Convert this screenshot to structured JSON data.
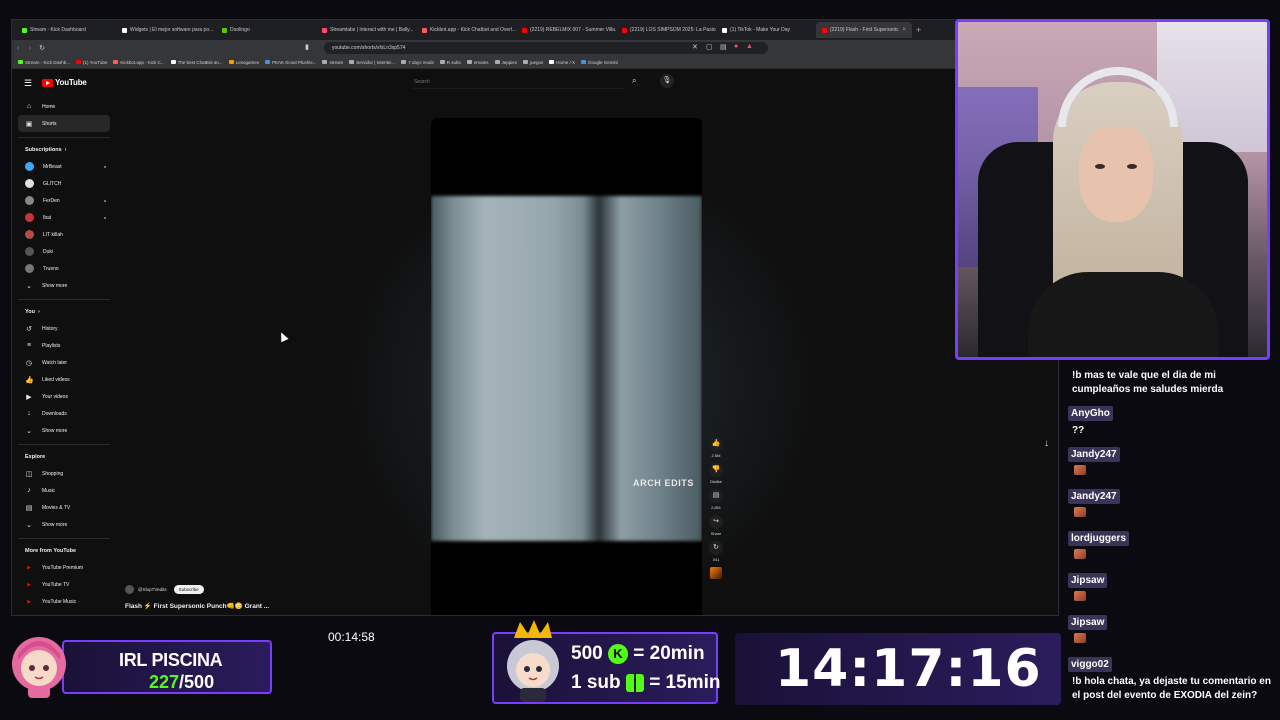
{
  "browser": {
    "tabs": [
      {
        "label": "Stream - Kick Dashboard",
        "color": "#53fc18"
      },
      {
        "label": "Widgets | El mejor software para po...",
        "color": "#ffffff"
      },
      {
        "label": "Duolingo",
        "color": "#58cc02"
      },
      {
        "label": "Streamlabs | Interact with me | Bally...",
        "color": "#ff4a6b"
      },
      {
        "label": "Kickbot.app - Kick Chatbot and Overl...",
        "color": "#ff5b5b"
      },
      {
        "label": "(2219) REBELMIX 007 - Summer Villa...",
        "color": "#ff0000"
      },
      {
        "label": "(2219) LOS SIMPSOM 2025: La Pasio...",
        "color": "#ff0000"
      },
      {
        "label": "(1) TikTok - Make Your Day",
        "color": "#ffffff"
      },
      {
        "label": "(2219) Flash - First Supersonic",
        "color": "#ff0000",
        "active": true
      }
    ],
    "new_tab": "+",
    "url": "youtube.com/shorts/xfxLn3xp574",
    "bookmarks": [
      {
        "label": "Stream - Kick Dashb...",
        "color": "#53fc18"
      },
      {
        "label": "(1) YouTube",
        "color": "#ff0000"
      },
      {
        "label": "Kickbot.app - Kick C...",
        "color": "#ff5b5b"
      },
      {
        "label": "The best ChatBot an...",
        "color": "#ffffff"
      },
      {
        "label": "Lesogames",
        "color": "#ff9a00"
      },
      {
        "label": "PEAK Scout Plushie...",
        "color": "#4a90e2"
      },
      {
        "label": "stream",
        "color": "#aaaaaa"
      },
      {
        "label": "Servidor | Intentei...",
        "color": "#aaaaaa"
      },
      {
        "label": "7 days mods",
        "color": "#aaaaaa"
      },
      {
        "label": "R subs",
        "color": "#aaaaaa"
      },
      {
        "label": "emotes",
        "color": "#aaaaaa"
      },
      {
        "label": "Jeppies",
        "color": "#aaaaaa"
      },
      {
        "label": "juegos",
        "color": "#aaaaaa"
      },
      {
        "label": "Home / X",
        "color": "#ffffff"
      },
      {
        "label": "Google Gemini",
        "color": "#4a90e2"
      }
    ]
  },
  "youtube": {
    "logo_text": "YouTube",
    "search_placeholder": "Search",
    "nav": [
      {
        "label": "Home",
        "icon": "home-icon",
        "glyph": "⌂"
      },
      {
        "label": "Shorts",
        "icon": "shorts-icon",
        "glyph": "▣",
        "active": true
      }
    ],
    "subscriptions_heading": "Subscriptions",
    "subscriptions": [
      {
        "label": "MrBeast",
        "color": "#3ea6ff",
        "dot": true
      },
      {
        "label": "GLITCH",
        "color": "#e0e0e0",
        "dot": false
      },
      {
        "label": "FerDen",
        "color": "#888888",
        "dot": true
      },
      {
        "label": "Ibai",
        "color": "#cc3333",
        "dot": true
      },
      {
        "label": "LIT killah",
        "color": "#b84a4a",
        "dot": false
      },
      {
        "label": "Duki",
        "color": "#555555",
        "dot": false
      },
      {
        "label": "Trueno",
        "color": "#777777",
        "dot": false
      }
    ],
    "show_more": "Show more",
    "you_heading": "You",
    "you_items": [
      {
        "label": "History",
        "icon": "history-icon",
        "glyph": "↺"
      },
      {
        "label": "Playlists",
        "icon": "playlists-icon",
        "glyph": "≡"
      },
      {
        "label": "Watch later",
        "icon": "clock-icon",
        "glyph": "◷"
      },
      {
        "label": "Liked videos",
        "icon": "thumbs-up-icon",
        "glyph": "👍"
      },
      {
        "label": "Your videos",
        "icon": "video-icon",
        "glyph": "▶"
      },
      {
        "label": "Downloads",
        "icon": "download-icon",
        "glyph": "↓"
      }
    ],
    "explore_heading": "Explore",
    "explore_items": [
      {
        "label": "Shopping",
        "icon": "bag-icon",
        "glyph": "◫"
      },
      {
        "label": "Music",
        "icon": "music-icon",
        "glyph": "♪"
      },
      {
        "label": "Movies & TV",
        "icon": "film-icon",
        "glyph": "▤"
      }
    ],
    "more_heading": "More from YouTube",
    "more_items": [
      {
        "label": "YouTube Premium"
      },
      {
        "label": "YouTube TV"
      },
      {
        "label": "YouTube Music"
      }
    ],
    "short": {
      "watermark": "ARCH EDITS",
      "progress": 0.25,
      "channel": "@SlopTVedits",
      "subscribe_label": "Subscribe",
      "title": "Flash ⚡ First Supersonic Punch👊😳 Grant ...",
      "actions": [
        {
          "name": "like",
          "icon": "thumbs-up-icon",
          "glyph": "👍",
          "label": "2.5M"
        },
        {
          "name": "dislike",
          "icon": "thumbs-down-icon",
          "glyph": "👎",
          "label": "Dislike"
        },
        {
          "name": "comments",
          "icon": "comment-icon",
          "glyph": "▤",
          "label": "2,851"
        },
        {
          "name": "share",
          "icon": "share-icon",
          "glyph": "↪",
          "label": "Share"
        },
        {
          "name": "remix",
          "icon": "remix-icon",
          "glyph": "↻",
          "label": "341"
        }
      ]
    }
  },
  "chat": [
    {
      "user": "",
      "text": "!b mas te vale que el dia de mi cumpleaños me saludes mierda"
    },
    {
      "user": "AnyGho",
      "text": "??"
    },
    {
      "user": "Jandy247",
      "text": "",
      "emote": true
    },
    {
      "user": "Jandy247",
      "text": "",
      "emote": true
    },
    {
      "user": "lordjuggers",
      "text": "",
      "emote": true
    },
    {
      "user": "Jipsaw",
      "text": "",
      "emote": true
    },
    {
      "user": "Jipsaw",
      "text": "",
      "emote": true
    },
    {
      "user": "viggo02",
      "text": "!b hola chata, ya dejaste tu comentario en el post del evento de EXODIA del zein?"
    }
  ],
  "overlay": {
    "goal_title": "IRL PISCINA",
    "goal_current": "227",
    "goal_total": "/500",
    "stream_timer": "00:14:58",
    "promo_line1_value": "500",
    "promo_line1_rest": "= 20min",
    "promo_line2_value": "1 sub",
    "promo_line2_rest": "= 15min",
    "kick_letter": "K",
    "clock": "14:17:16",
    "accent": "#7a3cff",
    "kick_green": "#53fc18"
  }
}
